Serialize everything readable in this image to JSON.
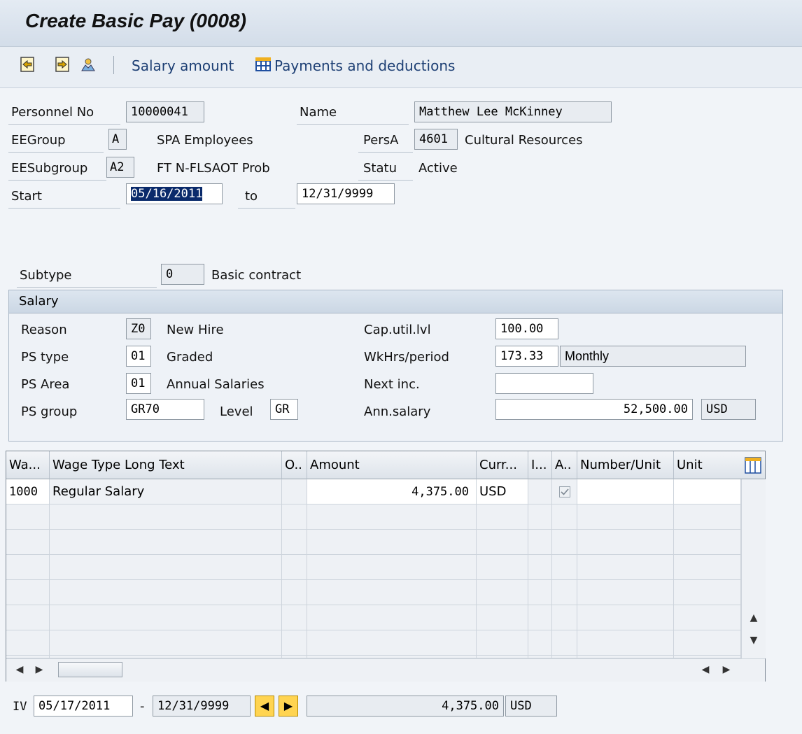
{
  "title": "Create Basic Pay (0008)",
  "toolbar": {
    "salary_amount": "Salary amount",
    "payments_deductions": "Payments and deductions"
  },
  "header": {
    "personnel_no_label": "Personnel No",
    "personnel_no": "10000041",
    "name_label": "Name",
    "name": "Matthew Lee McKinney",
    "eegroup_label": "EEGroup",
    "eegroup": "A",
    "eegroup_text": "SPA Employees",
    "persa_label": "PersA",
    "persa": "4601",
    "persa_text": "Cultural Resources",
    "eesubgroup_label": "EESubgroup",
    "eesubgroup": "A2",
    "eesubgroup_text": "FT N-FLSAOT Prob",
    "status_label": "Statu",
    "status": "Active",
    "start_label": "Start",
    "start": "05/16/2011",
    "to_label": "to",
    "end": "12/31/9999"
  },
  "subtype": {
    "label": "Subtype",
    "value": "0",
    "text": "Basic contract"
  },
  "salary": {
    "title": "Salary",
    "reason_label": "Reason",
    "reason": "Z0",
    "reason_text": "New Hire",
    "pstype_label": "PS type",
    "pstype": "01",
    "pstype_text": "Graded",
    "psarea_label": "PS Area",
    "psarea": "01",
    "psarea_text": "Annual Salaries",
    "psgroup_label": "PS group",
    "psgroup": "GR70",
    "level_label": "Level",
    "level": "GR",
    "caputil_label": "Cap.util.lvl",
    "caputil": "100.00",
    "wkhrs_label": "WkHrs/period",
    "wkhrs": "173.33",
    "wkhrs_text": "Monthly",
    "nextinc_label": "Next inc.",
    "nextinc": "",
    "annsalary_label": "Ann.salary",
    "annsalary": "52,500.00",
    "currency": "USD"
  },
  "table": {
    "columns": [
      "Wa...",
      "Wage Type Long Text",
      "O..",
      "Amount",
      "Curr...",
      "I...",
      "A..",
      "Number/Unit",
      "Unit"
    ],
    "rows": [
      {
        "wage_type": "1000",
        "long_text": "Regular Salary",
        "amount": "4,375.00",
        "currency": "USD",
        "assign": true
      }
    ],
    "empty_rows": 7
  },
  "footer": {
    "iv_label": "IV",
    "from": "05/17/2011",
    "dash": "-",
    "to": "12/31/9999",
    "total": "4,375.00",
    "currency": "USD"
  }
}
